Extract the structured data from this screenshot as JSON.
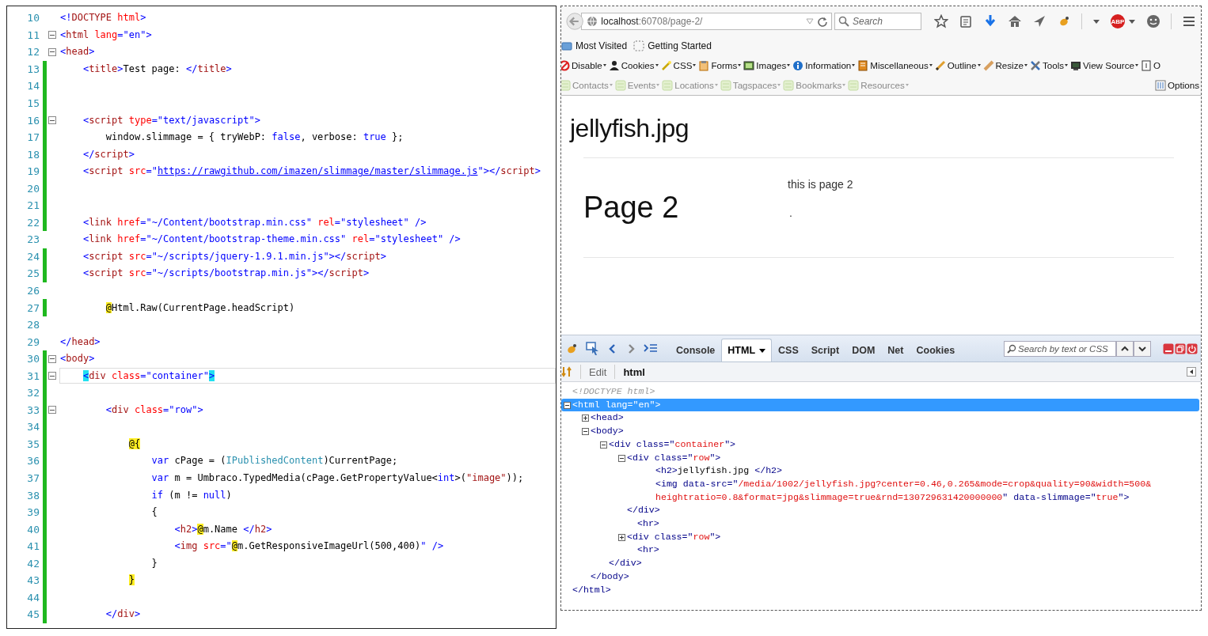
{
  "editor": {
    "lines": [
      {
        "n": "10",
        "modified": false,
        "fold": false,
        "current": false,
        "tokens": [
          {
            "kind": "d",
            "text": "<!"
          },
          {
            "kind": "n",
            "text": "DOCTYPE"
          },
          {
            "kind": "a",
            "text": " html"
          },
          {
            "kind": "d",
            "text": ">"
          }
        ]
      },
      {
        "n": "11",
        "modified": false,
        "fold": true,
        "current": false,
        "tokens": [
          {
            "kind": "d",
            "text": "<"
          },
          {
            "kind": "n",
            "text": "html"
          },
          {
            "kind": "a",
            "text": " lang"
          },
          {
            "kind": "d",
            "text": "=\"en\">"
          }
        ]
      },
      {
        "n": "12",
        "modified": false,
        "fold": true,
        "current": false,
        "tokens": [
          {
            "kind": "d",
            "text": "<"
          },
          {
            "kind": "n",
            "text": "head"
          },
          {
            "kind": "d",
            "text": ">"
          }
        ]
      },
      {
        "n": "13",
        "modified": true,
        "fold": false,
        "current": false,
        "tokens": [
          {
            "kind": "d",
            "text": "    <"
          },
          {
            "kind": "n",
            "text": "title"
          },
          {
            "kind": "d",
            "text": ">"
          },
          {
            "kind": "x",
            "text": "Test page: "
          },
          {
            "kind": "d",
            "text": "</"
          },
          {
            "kind": "n",
            "text": "title"
          },
          {
            "kind": "d",
            "text": ">"
          }
        ]
      },
      {
        "n": "14",
        "modified": true,
        "fold": false,
        "current": false
      },
      {
        "n": "15",
        "modified": true,
        "fold": false,
        "current": false
      },
      {
        "n": "16",
        "modified": true,
        "fold": true,
        "current": false,
        "tokens": [
          {
            "kind": "d",
            "text": "    <"
          },
          {
            "kind": "n",
            "text": "script"
          },
          {
            "kind": "a",
            "text": " type"
          },
          {
            "kind": "d",
            "text": "=\"text/javascript\">"
          }
        ]
      },
      {
        "n": "17",
        "modified": true,
        "fold": false,
        "current": false,
        "tokens": [
          {
            "kind": "x",
            "text": "        window.slimmage = { tryWebP: "
          },
          {
            "kind": "k",
            "text": "false"
          },
          {
            "kind": "x",
            "text": ", verbose: "
          },
          {
            "kind": "k",
            "text": "true"
          },
          {
            "kind": "x",
            "text": " };"
          }
        ]
      },
      {
        "n": "18",
        "modified": true,
        "fold": false,
        "current": false,
        "tokens": [
          {
            "kind": "d",
            "text": "    </"
          },
          {
            "kind": "n",
            "text": "script"
          },
          {
            "kind": "d",
            "text": ">"
          }
        ]
      },
      {
        "n": "19",
        "modified": true,
        "fold": false,
        "current": false,
        "tokens": [
          {
            "kind": "d",
            "text": "    <"
          },
          {
            "kind": "n",
            "text": "script"
          },
          {
            "kind": "a",
            "text": " src"
          },
          {
            "kind": "d",
            "text": "=\""
          },
          {
            "kind": "u",
            "text": "https://rawgithub.com/imazen/slimmage/master/slimmage.js"
          },
          {
            "kind": "d",
            "text": "\"></"
          },
          {
            "kind": "n",
            "text": "script"
          },
          {
            "kind": "d",
            "text": ">"
          }
        ]
      },
      {
        "n": "20",
        "modified": true,
        "fold": false,
        "current": false
      },
      {
        "n": "21",
        "modified": true,
        "fold": false,
        "current": false
      },
      {
        "n": "22",
        "modified": true,
        "fold": false,
        "current": false,
        "tokens": [
          {
            "kind": "d",
            "text": "    <"
          },
          {
            "kind": "n",
            "text": "link"
          },
          {
            "kind": "a",
            "text": " href"
          },
          {
            "kind": "d",
            "text": "=\"~/Content/bootstrap.min.css\""
          },
          {
            "kind": "a",
            "text": " rel"
          },
          {
            "kind": "d",
            "text": "=\"stylesheet\" />"
          }
        ]
      },
      {
        "n": "23",
        "modified": false,
        "fold": false,
        "current": false,
        "tokens": [
          {
            "kind": "d",
            "text": "    <"
          },
          {
            "kind": "n",
            "text": "link"
          },
          {
            "kind": "a",
            "text": " href"
          },
          {
            "kind": "d",
            "text": "=\"~/Content/bootstrap-theme.min.css\""
          },
          {
            "kind": "a",
            "text": " rel"
          },
          {
            "kind": "d",
            "text": "=\"stylesheet\" />"
          }
        ]
      },
      {
        "n": "24",
        "modified": true,
        "fold": false,
        "current": false,
        "tokens": [
          {
            "kind": "d",
            "text": "    <"
          },
          {
            "kind": "n",
            "text": "script"
          },
          {
            "kind": "a",
            "text": " src"
          },
          {
            "kind": "d",
            "text": "=\"~/scripts/jquery-1.9.1.min.js\"></"
          },
          {
            "kind": "n",
            "text": "script"
          },
          {
            "kind": "d",
            "text": ">"
          }
        ]
      },
      {
        "n": "25",
        "modified": true,
        "fold": false,
        "current": false,
        "tokens": [
          {
            "kind": "d",
            "text": "    <"
          },
          {
            "kind": "n",
            "text": "script"
          },
          {
            "kind": "a",
            "text": " src"
          },
          {
            "kind": "d",
            "text": "=\"~/scripts/bootstrap.min.js\"></"
          },
          {
            "kind": "n",
            "text": "script"
          },
          {
            "kind": "d",
            "text": ">"
          }
        ]
      },
      {
        "n": "26",
        "modified": false,
        "fold": false,
        "current": false
      },
      {
        "n": "27",
        "modified": true,
        "fold": false,
        "current": false,
        "tokens": [
          {
            "kind": "at",
            "text": "        @"
          },
          {
            "kind": "x",
            "text": "Html.Raw(CurrentPage.headScript)"
          }
        ]
      },
      {
        "n": "28",
        "modified": false,
        "fold": false,
        "current": false
      },
      {
        "n": "29",
        "modified": false,
        "fold": false,
        "current": false,
        "tokens": [
          {
            "kind": "d",
            "text": "</"
          },
          {
            "kind": "n",
            "text": "head"
          },
          {
            "kind": "d",
            "text": ">"
          }
        ]
      },
      {
        "n": "30",
        "modified": true,
        "fold": true,
        "current": false,
        "tokens": [
          {
            "kind": "d",
            "text": "<"
          },
          {
            "kind": "n",
            "text": "body"
          },
          {
            "kind": "d",
            "text": ">"
          }
        ]
      },
      {
        "n": "31",
        "modified": true,
        "fold": true,
        "current": true,
        "tokens": [
          {
            "kind": "hl",
            "text": "    <"
          },
          {
            "kind": "n",
            "text": "div"
          },
          {
            "kind": "a",
            "text": " class"
          },
          {
            "kind": "d",
            "text": "=\"container\""
          },
          {
            "kind": "hl",
            "text": ">"
          }
        ]
      },
      {
        "n": "32",
        "modified": true,
        "fold": false,
        "current": false
      },
      {
        "n": "33",
        "modified": true,
        "fold": true,
        "current": false,
        "tokens": [
          {
            "kind": "d",
            "text": "        <"
          },
          {
            "kind": "n",
            "text": "div"
          },
          {
            "kind": "a",
            "text": " class"
          },
          {
            "kind": "d",
            "text": "=\"row\">"
          }
        ]
      },
      {
        "n": "34",
        "modified": true,
        "fold": false,
        "current": false
      },
      {
        "n": "35",
        "modified": true,
        "fold": false,
        "current": false,
        "tokens": [
          {
            "kind": "at",
            "text": "            @{"
          }
        ]
      },
      {
        "n": "36",
        "modified": true,
        "fold": false,
        "current": false,
        "tokens": [
          {
            "kind": "k",
            "text": "                var"
          },
          {
            "kind": "x",
            "text": " cPage = ("
          },
          {
            "kind": "ty",
            "text": "IPublishedContent"
          },
          {
            "kind": "x",
            "text": ")CurrentPage;"
          }
        ]
      },
      {
        "n": "37",
        "modified": true,
        "fold": false,
        "current": false,
        "tokens": [
          {
            "kind": "k",
            "text": "                var"
          },
          {
            "kind": "x",
            "text": " m = Umbraco.TypedMedia(cPage.GetPropertyValue<"
          },
          {
            "kind": "k",
            "text": "int"
          },
          {
            "kind": "x",
            "text": ">("
          },
          {
            "kind": "s",
            "text": "\"image\""
          },
          {
            "kind": "x",
            "text": "));"
          }
        ]
      },
      {
        "n": "38",
        "modified": true,
        "fold": false,
        "current": false,
        "tokens": [
          {
            "kind": "k",
            "text": "                if"
          },
          {
            "kind": "x",
            "text": " (m != "
          },
          {
            "kind": "k",
            "text": "null"
          },
          {
            "kind": "x",
            "text": ")"
          }
        ]
      },
      {
        "n": "39",
        "modified": true,
        "fold": false,
        "current": false,
        "tokens": [
          {
            "kind": "x",
            "text": "                {"
          }
        ]
      },
      {
        "n": "40",
        "modified": true,
        "fold": false,
        "current": false,
        "tokens": [
          {
            "kind": "d",
            "text": "                    <"
          },
          {
            "kind": "n",
            "text": "h2"
          },
          {
            "kind": "d",
            "text": ">"
          },
          {
            "kind": "at",
            "text": "@"
          },
          {
            "kind": "x",
            "text": "m.Name "
          },
          {
            "kind": "d",
            "text": "</"
          },
          {
            "kind": "n",
            "text": "h2"
          },
          {
            "kind": "d",
            "text": ">"
          }
        ]
      },
      {
        "n": "41",
        "modified": true,
        "fold": false,
        "current": false,
        "tokens": [
          {
            "kind": "d",
            "text": "                    <"
          },
          {
            "kind": "n",
            "text": "img"
          },
          {
            "kind": "a",
            "text": " src"
          },
          {
            "kind": "d",
            "text": "=\""
          },
          {
            "kind": "at",
            "text": "@"
          },
          {
            "kind": "x",
            "text": "m.GetResponsiveImageUrl(500,400)"
          },
          {
            "kind": "d",
            "text": "\" />"
          }
        ]
      },
      {
        "n": "42",
        "modified": true,
        "fold": false,
        "current": false,
        "tokens": [
          {
            "kind": "x",
            "text": "                }"
          }
        ]
      },
      {
        "n": "43",
        "modified": true,
        "fold": false,
        "current": false,
        "tokens": [
          {
            "kind": "at",
            "text": "            }"
          }
        ]
      },
      {
        "n": "44",
        "modified": true,
        "fold": false,
        "current": false
      },
      {
        "n": "45",
        "modified": true,
        "fold": false,
        "current": false,
        "tokens": [
          {
            "kind": "d",
            "text": "        </"
          },
          {
            "kind": "n",
            "text": "div"
          },
          {
            "kind": "d",
            "text": ">"
          }
        ]
      }
    ]
  },
  "browser": {
    "address": {
      "host": "localhost",
      "rest": ":60708/page-2/"
    },
    "search": {
      "placeholder": "Search"
    },
    "adblock_badge": "ABP",
    "bookmarks": [
      "Most Visited",
      "Getting Started"
    ],
    "dev_toolbar": [
      {
        "label": "Disable",
        "dropdown": true,
        "disabled": false
      },
      {
        "label": "Cookies",
        "dropdown": true,
        "disabled": false
      },
      {
        "label": "CSS",
        "dropdown": true,
        "disabled": false
      },
      {
        "label": "Forms",
        "dropdown": true,
        "disabled": false
      },
      {
        "label": "Images",
        "dropdown": true,
        "disabled": false
      },
      {
        "label": "Information",
        "dropdown": true,
        "disabled": false
      },
      {
        "label": "Miscellaneous",
        "dropdown": true,
        "disabled": false
      },
      {
        "label": "Outline",
        "dropdown": true,
        "disabled": false
      },
      {
        "label": "Resize",
        "dropdown": true,
        "disabled": false
      },
      {
        "label": "Tools",
        "dropdown": true,
        "disabled": false
      },
      {
        "label": "View Source",
        "dropdown": true,
        "disabled": false
      },
      {
        "label": "O",
        "dropdown": false,
        "disabled": false
      }
    ],
    "dev_toolbar_2": [
      {
        "label": "Contacts",
        "dropdown": true,
        "disabled": true
      },
      {
        "label": "Events",
        "dropdown": true,
        "disabled": true
      },
      {
        "label": "Locations",
        "dropdown": true,
        "disabled": true
      },
      {
        "label": "Tagspaces",
        "dropdown": true,
        "disabled": true
      },
      {
        "label": "Bookmarks",
        "dropdown": true,
        "disabled": true
      },
      {
        "label": "Resources",
        "dropdown": true,
        "disabled": true
      }
    ],
    "options": "Options",
    "page": {
      "title": "jellyfish.jpg",
      "heading": "Page 2",
      "text": "this is page 2",
      "dot": "."
    },
    "firebug": {
      "tabs": [
        {
          "label": "Console",
          "dropdown": false,
          "selected": false
        },
        {
          "label": "HTML",
          "dropdown": true,
          "selected": true
        },
        {
          "label": "CSS",
          "dropdown": false,
          "selected": false
        },
        {
          "label": "Script",
          "dropdown": false,
          "selected": false
        },
        {
          "label": "DOM",
          "dropdown": false,
          "selected": false
        },
        {
          "label": "Net",
          "dropdown": false,
          "selected": false
        },
        {
          "label": "Cookies",
          "dropdown": false,
          "selected": false
        }
      ],
      "search": {
        "placeholder": "Search by text or CSS"
      },
      "edit": "Edit",
      "breadcrumb": "html",
      "tree": [
        {
          "kind": "doctype",
          "selected": false,
          "lines": [
            [
              {
                "kind": "c",
                "text": "<!DOCTYPE html>"
              }
            ]
          ]
        },
        {
          "kind": "element",
          "expanded": true,
          "selected": true,
          "lines": [
            [
              {
                "kind": "t",
                "text": "<html lang=\""
              },
              {
                "kind": "v",
                "text": "en"
              },
              {
                "kind": "t",
                "text": "\">"
              }
            ]
          ],
          "close": [
            {
              "kind": "t",
              "text": "</html>"
            }
          ],
          "children": [
            {
              "kind": "element",
              "expanded": false,
              "selected": false,
              "lines": [
                [
                  {
                    "kind": "t",
                    "text": "<head>"
                  }
                ]
              ]
            },
            {
              "kind": "element",
              "expanded": true,
              "selected": false,
              "lines": [
                [
                  {
                    "kind": "t",
                    "text": "<body>"
                  }
                ]
              ],
              "close": [
                {
                  "kind": "t",
                  "text": "</body>"
                }
              ],
              "children": [
                {
                  "kind": "element",
                  "expanded": true,
                  "selected": false,
                  "lines": [
                    [
                      {
                        "kind": "t",
                        "text": "<div class=\""
                      },
                      {
                        "kind": "v",
                        "text": "container"
                      },
                      {
                        "kind": "t",
                        "text": "\">"
                      }
                    ]
                  ],
                  "close": [
                    {
                      "kind": "t",
                      "text": "</div>"
                    }
                  ],
                  "children": [
                    {
                      "kind": "element",
                      "expanded": true,
                      "selected": false,
                      "lines": [
                        [
                          {
                            "kind": "t",
                            "text": "<div class=\""
                          },
                          {
                            "kind": "v",
                            "text": "row"
                          },
                          {
                            "kind": "t",
                            "text": "\">"
                          }
                        ]
                      ],
                      "close": [
                        {
                          "kind": "t",
                          "text": "</div>"
                        }
                      ],
                      "children": [
                        {
                          "kind": "leaf",
                          "selected": false,
                          "lines": [
                            [
                              {
                                "kind": "t",
                                "text": "<h2>"
                              },
                              {
                                "kind": "x",
                                "text": "jellyfish.jpg "
                              },
                              {
                                "kind": "t",
                                "text": "</h2>"
                              }
                            ]
                          ]
                        },
                        {
                          "kind": "leaf",
                          "selected": false,
                          "lines": [
                            [
                              {
                                "kind": "t",
                                "text": "<img data-src=\""
                              },
                              {
                                "kind": "v",
                                "text": "/media/1002/jellyfish.jpg?center=0.46,0.265&mode=crop&quality=90&width=500&"
                              }
                            ],
                            [
                              {
                                "kind": "v",
                                "text": "heightratio=0.8&format=jpg&slimmage=true&rnd=130729631420000000"
                              },
                              {
                                "kind": "t",
                                "text": "\" data-slimmage=\""
                              },
                              {
                                "kind": "v",
                                "text": "true"
                              },
                              {
                                "kind": "t",
                                "text": "\">"
                              }
                            ]
                          ]
                        }
                      ]
                    },
                    {
                      "kind": "leaf",
                      "selected": false,
                      "lines": [
                        [
                          {
                            "kind": "t",
                            "text": "<hr>"
                          }
                        ]
                      ]
                    },
                    {
                      "kind": "element",
                      "expanded": false,
                      "selected": false,
                      "lines": [
                        [
                          {
                            "kind": "t",
                            "text": "<div class=\""
                          },
                          {
                            "kind": "v",
                            "text": "row"
                          },
                          {
                            "kind": "t",
                            "text": "\">"
                          }
                        ]
                      ]
                    },
                    {
                      "kind": "leaf",
                      "selected": false,
                      "lines": [
                        [
                          {
                            "kind": "t",
                            "text": "<hr>"
                          }
                        ]
                      ]
                    }
                  ]
                }
              ]
            }
          ]
        }
      ]
    }
  }
}
